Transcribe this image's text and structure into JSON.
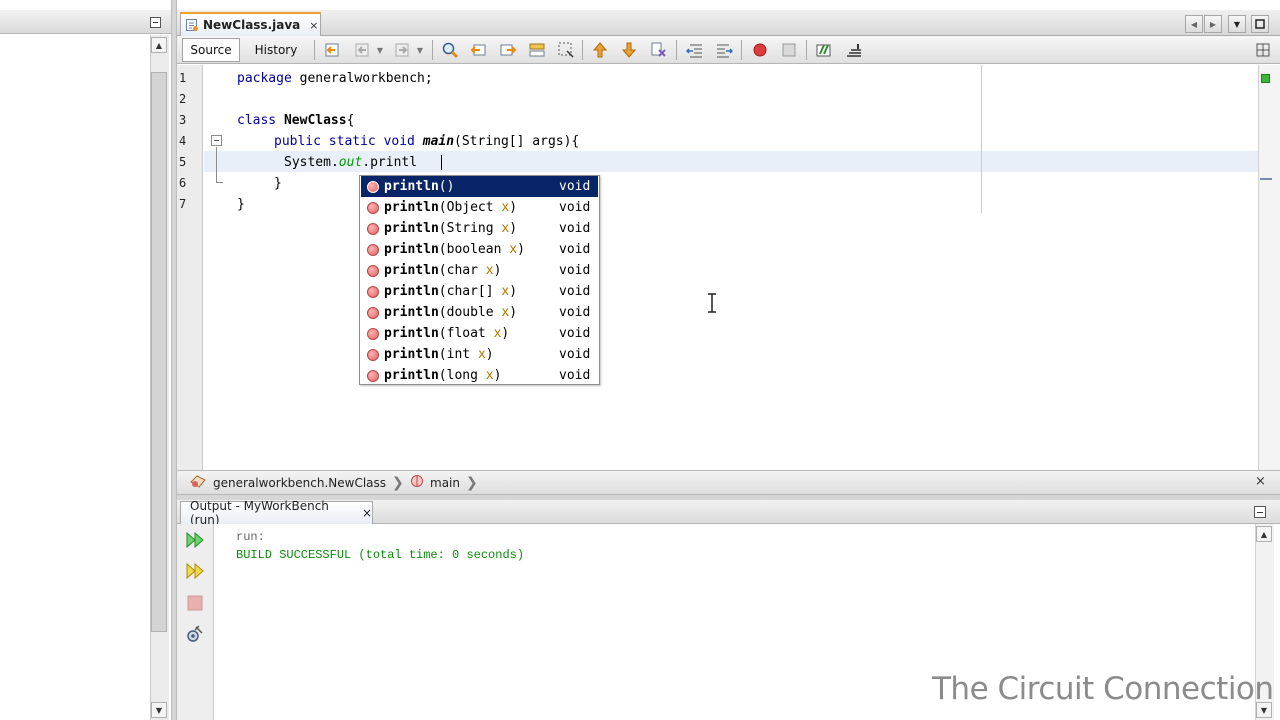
{
  "editor": {
    "tab_label": "NewClass.java",
    "tab_close": "×",
    "toolbar": {
      "source_label": "Source",
      "history_label": "History"
    },
    "line_numbers": [
      "1",
      "2",
      "3",
      "4",
      "5",
      "6",
      "7"
    ],
    "code": {
      "l1_kw": "package",
      "l1_rest": " generalworkbench;",
      "l3_kw": "class",
      "l3_name": "NewClass",
      "l3_rest": "{",
      "l4_kw": "public static void",
      "l4_method": "main",
      "l4_rest": "(String[] args){",
      "l5_pre": "System.",
      "l5_field": "out",
      "l5_rest": ".printl",
      "l6": "}",
      "l7": "}"
    },
    "completion": [
      {
        "name": "println",
        "pre": "()",
        "param": "",
        "post": "",
        "ret": "void",
        "selected": true
      },
      {
        "name": "println",
        "pre": "(Object ",
        "param": "x",
        "post": ")",
        "ret": "void"
      },
      {
        "name": "println",
        "pre": "(String ",
        "param": "x",
        "post": ")",
        "ret": "void"
      },
      {
        "name": "println",
        "pre": "(boolean ",
        "param": "x",
        "post": ")",
        "ret": "void"
      },
      {
        "name": "println",
        "pre": "(char ",
        "param": "x",
        "post": ")",
        "ret": "void"
      },
      {
        "name": "println",
        "pre": "(char[] ",
        "param": "x",
        "post": ")",
        "ret": "void"
      },
      {
        "name": "println",
        "pre": "(double ",
        "param": "x",
        "post": ")",
        "ret": "void"
      },
      {
        "name": "println",
        "pre": "(float ",
        "param": "x",
        "post": ")",
        "ret": "void"
      },
      {
        "name": "println",
        "pre": "(int ",
        "param": "x",
        "post": ")",
        "ret": "void"
      },
      {
        "name": "println",
        "pre": "(long ",
        "param": "x",
        "post": ")",
        "ret": "void"
      }
    ],
    "breadcrumb": {
      "class_path": "generalworkbench.NewClass",
      "method": "main",
      "close": "×"
    }
  },
  "output": {
    "tab_label": "Output - MyWorkBench (run)",
    "tab_close": "×",
    "lines": {
      "run": "run:",
      "build": "BUILD SUCCESSFUL (total time: 0 seconds)"
    }
  },
  "watermark": "The Circuit Connection",
  "colors": {
    "selection": "#0a2468",
    "keyword": "#00009a",
    "success": "#0b8a0b",
    "tab_accent": "#f0a030"
  },
  "icons": [
    "java-file-icon",
    "run-icon",
    "rerun-icon",
    "stop-icon",
    "settings-icon",
    "method-icon",
    "class-icon"
  ]
}
